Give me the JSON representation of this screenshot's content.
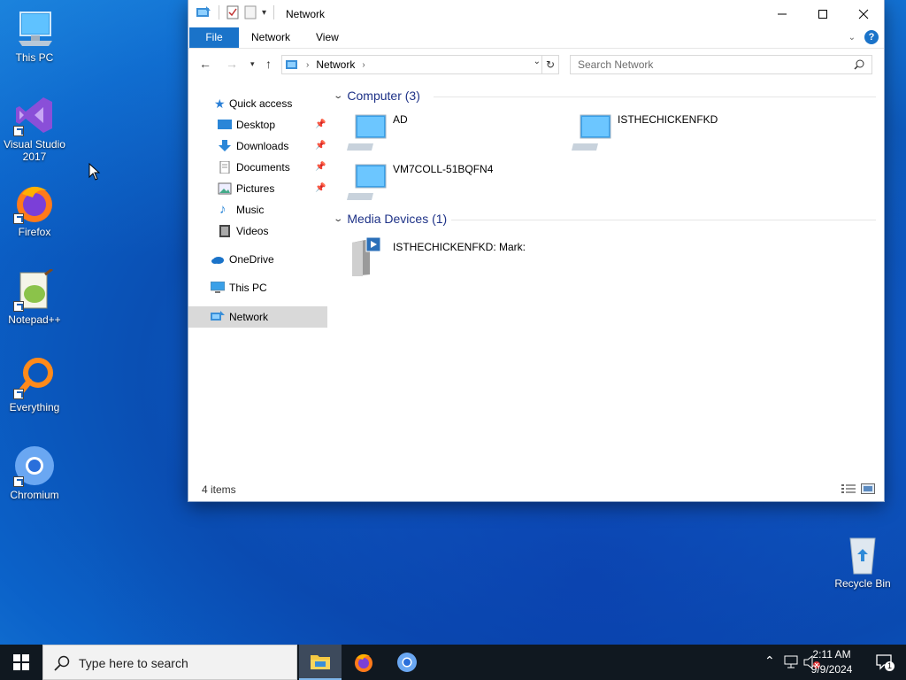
{
  "desktop": {
    "icons": [
      {
        "label": "This PC"
      },
      {
        "label": "Visual Studio\n2017"
      },
      {
        "label": "Firefox"
      },
      {
        "label": "Notepad++"
      },
      {
        "label": "Everything"
      },
      {
        "label": "Chromium"
      },
      {
        "label": "Recycle Bin"
      }
    ]
  },
  "window": {
    "title": "Network",
    "ribbon_tabs": {
      "file": "File",
      "network": "Network",
      "view": "View"
    },
    "help_label": "?",
    "address": {
      "path": "Network"
    },
    "search": {
      "placeholder": "Search Network"
    },
    "nav": {
      "quick_access": "Quick access",
      "desktop": "Desktop",
      "downloads": "Downloads",
      "documents": "Documents",
      "pictures": "Pictures",
      "music": "Music",
      "videos": "Videos",
      "onedrive": "OneDrive",
      "this_pc": "This PC",
      "network": "Network"
    },
    "groups": {
      "computer": {
        "title": "Computer (3)",
        "items": [
          "AD",
          "ISTHECHICKENFKD",
          "VM7COLL-51BQFN4"
        ]
      },
      "media": {
        "title": "Media Devices (1)",
        "items": [
          "ISTHECHICKENFKD: Mark:"
        ]
      }
    },
    "status": "4 items"
  },
  "taskbar": {
    "search_placeholder": "Type here to search",
    "time": "2:11 AM",
    "date": "9/9/2024",
    "notification_count": "1"
  },
  "colors": {
    "accent": "#1a73c9",
    "group_header": "#1e3287",
    "taskbar": "#101820"
  }
}
